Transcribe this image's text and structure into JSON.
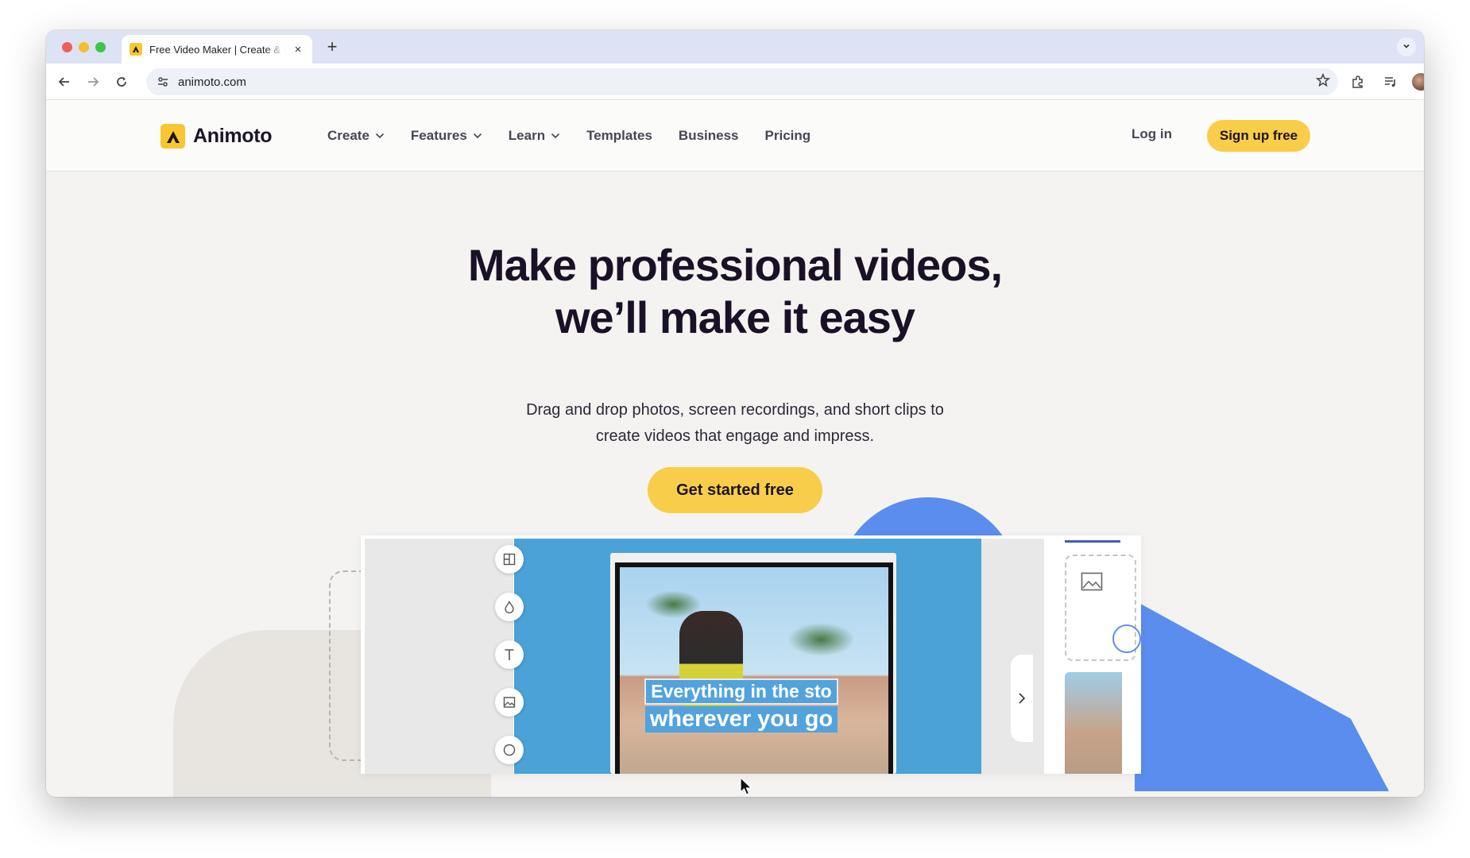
{
  "browser": {
    "tab_title": "Free Video Maker | Create & Edit",
    "url": "animoto.com",
    "new_tab_symbol": "+",
    "close_symbol": "×"
  },
  "nav": {
    "logo_text": "Animoto",
    "links": [
      {
        "label": "Create",
        "dropdown": true
      },
      {
        "label": "Features",
        "dropdown": true
      },
      {
        "label": "Learn",
        "dropdown": true
      },
      {
        "label": "Templates",
        "dropdown": false
      },
      {
        "label": "Business",
        "dropdown": false
      },
      {
        "label": "Pricing",
        "dropdown": false
      }
    ],
    "login": "Log in",
    "signup": "Sign up free"
  },
  "hero": {
    "headline_line1": "Make professional videos,",
    "headline_line2": "we’ll make it easy",
    "subhead_line1": "Drag and drop photos, screen recordings, and short clips to",
    "subhead_line2": "create videos that engage and impress.",
    "cta": "Get started free"
  },
  "editor_preview": {
    "caption_line1": "Everything in the sto",
    "caption_line2": "wherever you go",
    "tools": [
      "layout-icon",
      "color-drop-icon",
      "text-icon",
      "image-icon",
      "sticker-icon"
    ]
  },
  "colors": {
    "brand_yellow": "#f8cd49",
    "heading_dark": "#1b1127",
    "accent_blue": "#5b8def",
    "canvas_blue": "#4aa2d7"
  }
}
